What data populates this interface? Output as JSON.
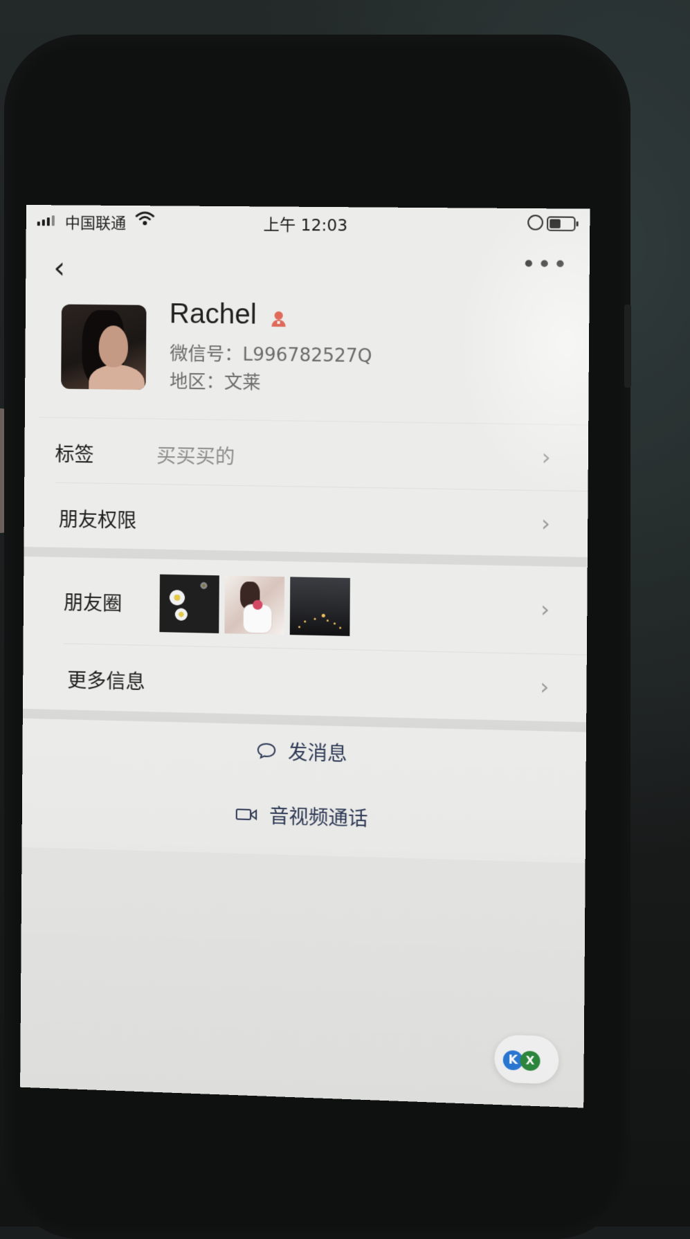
{
  "status_bar": {
    "carrier": "中国联通",
    "time": "上午 12:03",
    "battery_level": 0.55,
    "icons": [
      "signal-icon",
      "wifi-icon",
      "orientation-lock-icon",
      "battery-icon"
    ]
  },
  "nav": {
    "back_icon": "‹",
    "more_icon": "•••"
  },
  "profile": {
    "name": "Rachel",
    "gender_icon": "female-icon",
    "gender_color": "#e06a5a",
    "wechat_id": "微信号：L996782527Q",
    "region": "地区：文莱"
  },
  "rows": {
    "tags": {
      "label": "标签",
      "value": "买买买的"
    },
    "friend_permissions": {
      "label": "朋友权限"
    },
    "moments": {
      "label": "朋友圈"
    },
    "more_info": {
      "label": "更多信息"
    }
  },
  "actions": {
    "send_message": "发消息",
    "video_call": "音视频通话",
    "accent_color": "#2f3a56"
  },
  "floating_widget": {
    "left_letter": "K",
    "right_letter": "X"
  }
}
